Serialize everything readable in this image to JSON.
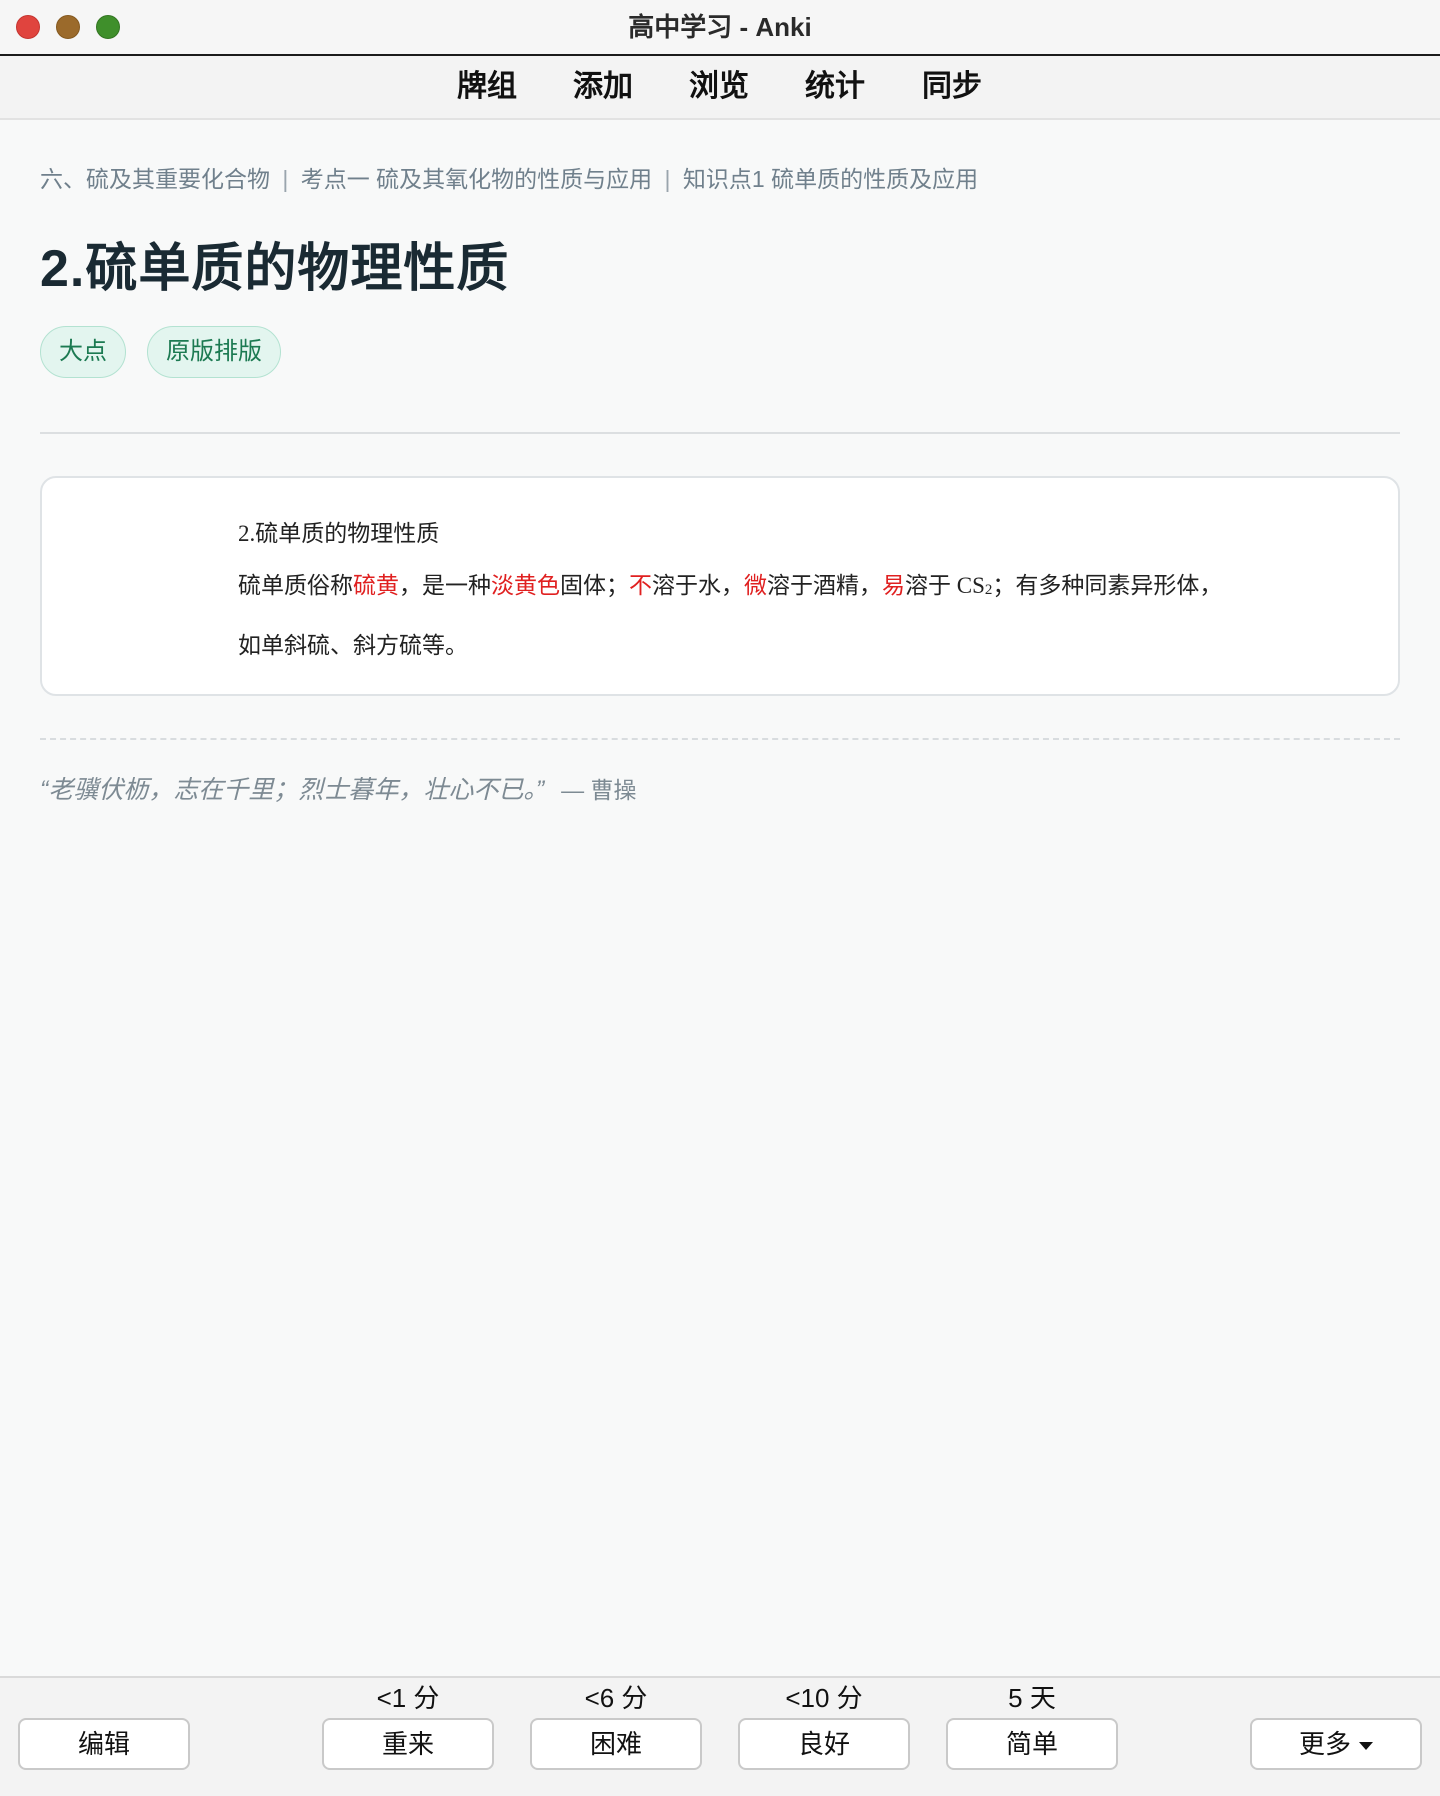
{
  "window": {
    "title": "高中学习 - Anki"
  },
  "toolbar": {
    "items": [
      "牌组",
      "添加",
      "浏览",
      "统计",
      "同步"
    ]
  },
  "card": {
    "breadcrumb": [
      "六、硫及其重要化合物",
      "考点一 硫及其氧化物的性质与应用",
      "知识点1 硫单质的性质及应用"
    ],
    "breadcrumb_separator": "|",
    "title": "2.硫单质的物理性质",
    "tags": [
      "大点",
      "原版排版"
    ],
    "content": {
      "heading": "2.硫单质的物理性质",
      "segments": [
        {
          "text": "硫单质俗称"
        },
        {
          "text": "硫黄",
          "highlight": true
        },
        {
          "text": "，是一种"
        },
        {
          "text": "淡黄色",
          "highlight": true
        },
        {
          "text": "固体；"
        },
        {
          "text": "不",
          "highlight": true
        },
        {
          "text": "溶于水，"
        },
        {
          "text": "微",
          "highlight": true
        },
        {
          "text": "溶于酒精，"
        },
        {
          "text": "易",
          "highlight": true
        },
        {
          "text": "溶于 CS"
        },
        {
          "text": "2",
          "subscript": true
        },
        {
          "text": "；有多种同素异形体，如单斜硫、斜方硫等。"
        }
      ],
      "highlight_color": "#e02020"
    },
    "quote": {
      "text": "“老骥伏枥，志在千里；烈士暮年，壮心不已。”",
      "author": "— 曹操"
    }
  },
  "answer_bar": {
    "edit_label": "编辑",
    "more_label": "更多",
    "buttons": [
      {
        "key": "again",
        "label": "重来",
        "interval": "<1 分"
      },
      {
        "key": "hard",
        "label": "困难",
        "interval": "<6 分"
      },
      {
        "key": "good",
        "label": "良好",
        "interval": "<10 分"
      },
      {
        "key": "easy",
        "label": "简单",
        "interval": "5 天"
      }
    ]
  },
  "colors": {
    "tag_bg": "#e3f5ef",
    "tag_text": "#1c7a52",
    "breadcrumb": "#70808c",
    "title": "#1a2a33"
  }
}
